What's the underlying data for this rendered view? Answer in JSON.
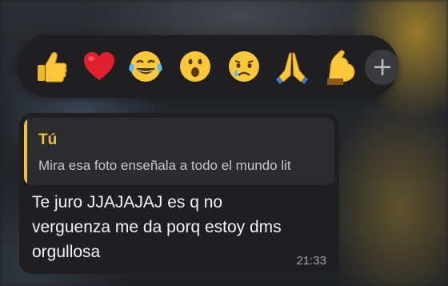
{
  "reaction_bar": {
    "reactions": [
      {
        "icon": "thumbs-up-icon"
      },
      {
        "icon": "red-heart-icon",
        "color": "#e0202e"
      },
      {
        "icon": "tears-of-joy-icon"
      },
      {
        "icon": "surprised-face-icon"
      },
      {
        "icon": "crying-face-icon"
      },
      {
        "icon": "folded-hands-icon"
      },
      {
        "icon": "flexed-biceps-icon"
      }
    ],
    "more_label": "+"
  },
  "message": {
    "reply": {
      "author": "Tú",
      "text": "Mira esa foto enseñala a todo el mundo lit",
      "accent_color": "#f0c23b"
    },
    "text": "Te juro JJAJAJAJ es q no verguenza me da porq estoy dms orgullosa",
    "time": "21:33"
  }
}
